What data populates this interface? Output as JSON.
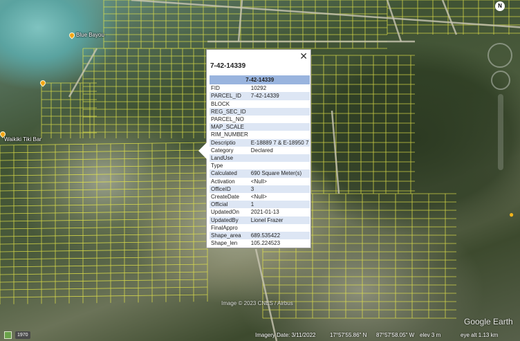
{
  "map": {
    "places": [
      {
        "name": "Blue Bayou"
      },
      {
        "name": ""
      },
      {
        "name": "Waikiki Tiki Bar"
      }
    ],
    "imagery_credit": "Image © 2023 CNES / Airbus",
    "brand": "Google Earth",
    "compass_label": "N"
  },
  "popup": {
    "title": "7-42-14339",
    "table_header": "7-42-14339",
    "close_icon": "close-icon",
    "rows": [
      {
        "key": "FID",
        "value": "10292"
      },
      {
        "key": "PARCEL_ID",
        "value": "7-42-14339"
      },
      {
        "key": "BLOCK",
        "value": ""
      },
      {
        "key": "REG_SEC_ID",
        "value": ""
      },
      {
        "key": "PARCEL_NO",
        "value": ""
      },
      {
        "key": "MAP_SCALE",
        "value": ""
      },
      {
        "key": "RIM_NUMBER",
        "value": ""
      },
      {
        "key": "Descriptio",
        "value": "E-18889 7 & E-18950 7"
      },
      {
        "key": "Category",
        "value": "Declared"
      },
      {
        "key": "LandUse",
        "value": ""
      },
      {
        "key": "Type",
        "value": ""
      },
      {
        "key": "Calculated",
        "value": "690 Square Meter(s)"
      },
      {
        "key": "Activation",
        "value": "<Null>"
      },
      {
        "key": "OfficeID",
        "value": "3"
      },
      {
        "key": "CreateDate",
        "value": "<Null>"
      },
      {
        "key": "Official",
        "value": "1"
      },
      {
        "key": "UpdatedOn",
        "value": "2021-01-13"
      },
      {
        "key": "UpdatedBy",
        "value": "Lionel Frazer"
      },
      {
        "key": "FinalAppro",
        "value": ""
      },
      {
        "key": "Shape_area",
        "value": "689.535422"
      },
      {
        "key": "Shape_len",
        "value": "105.224523"
      }
    ]
  },
  "status": {
    "year": "1970",
    "imagery_date": "Imagery Date: 3/11/2022",
    "lat": "17°57'55.86\" N",
    "lon": "87°57'58.05\" W",
    "elev": "elev   3 m",
    "eye_alt": "eye alt   1.13 km"
  },
  "colors": {
    "parcel_lines": "#e8e84a",
    "table_header": "#99b4de",
    "table_alt": "#dde6f4",
    "poi_pin": "#f3a514"
  }
}
